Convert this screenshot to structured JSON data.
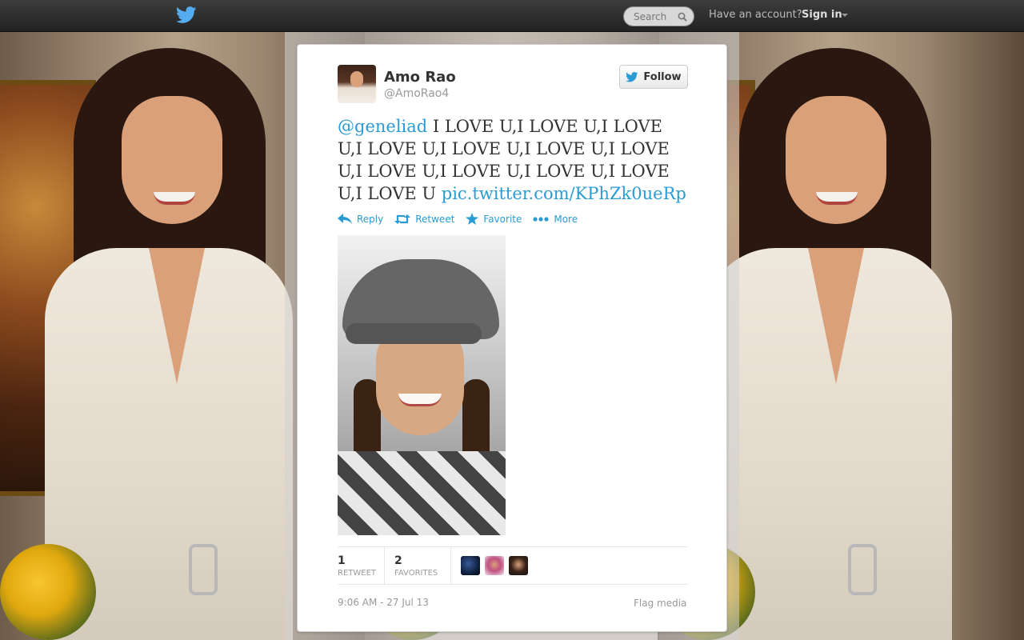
{
  "topbar": {
    "logo_icon": "twitter-bird-icon",
    "search_placeholder": "Search",
    "search_icon": "magnifier-icon",
    "have_account": "Have an account?",
    "sign_in": "Sign in",
    "caret_icon": "caret-down-icon"
  },
  "tweet": {
    "author_name": "Amo Rao",
    "author_handle": "@AmoRao4",
    "follow_label": "Follow",
    "mention": "@geneliad",
    "body": " I LOVE U,I LOVE U,I LOVE U,I LOVE U,I LOVE U,I LOVE U,I LOVE U,I LOVE U,I LOVE U,I LOVE U,I LOVE U,I LOVE U ",
    "link": "pic.twitter.com/KPhZk0ueRp",
    "actions": {
      "reply": "Reply",
      "retweet": "Retweet",
      "favorite": "Favorite",
      "more": "More"
    },
    "stats": {
      "retweets": "1",
      "retweets_label": "RETWEET",
      "favorites": "2",
      "favorites_label": "FAVORITES"
    },
    "timestamp": "9:06 AM - 27 Jul 13",
    "flag_media": "Flag media"
  },
  "colors": {
    "link": "#2a9bd4",
    "topbar": "#2b2b2b"
  }
}
